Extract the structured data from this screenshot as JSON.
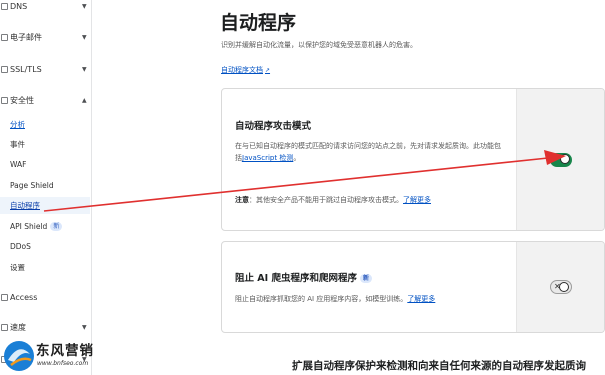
{
  "sidebar": {
    "items": [
      {
        "label": "DNS",
        "icon": "dns-icon"
      },
      {
        "label": "电子邮件",
        "icon": "email-icon"
      },
      {
        "label": "SSL/TLS",
        "icon": "lock-icon"
      },
      {
        "label": "安全性",
        "icon": "shield-icon"
      }
    ],
    "security_sub": [
      {
        "label": "分析"
      },
      {
        "label": "事件"
      },
      {
        "label": "WAF"
      },
      {
        "label": "Page Shield"
      },
      {
        "label": "自动程序"
      },
      {
        "label": "API Shield",
        "badge": "新"
      },
      {
        "label": "DDoS"
      },
      {
        "label": "设置"
      }
    ],
    "access": {
      "label": "Access"
    },
    "speed": {
      "label": "速度"
    },
    "cache": {
      "label": "缓存"
    }
  },
  "main": {
    "title": "自动程序",
    "description": "识别并缓解自动化流量，以保护您的域免受恶意机器人的危害。",
    "doc_link": "自动程序文档",
    "cards": [
      {
        "title": "自动程序攻击模式",
        "desc_before": "在与已知自动程序的模式匹配的请求访问您的站点之前，先对请求发起质询。此功能包括",
        "desc_link": "JavaScript 检测",
        "desc_after": "。",
        "note_label": "注意",
        "note_text": "：其他安全产品不能用于跳过自动程序攻击模式。",
        "note_link": "了解更多",
        "toggle": {
          "state": "on",
          "mark": "✓"
        }
      },
      {
        "title": "阻止 AI 爬虫程序和爬网程序",
        "badge": "新",
        "desc": "阻止自动程序抓取您的 AI 应用程序内容，如模型训练。",
        "desc_link": "了解更多",
        "toggle": {
          "state": "off",
          "mark": "✕"
        }
      }
    ],
    "bottom_heading": "扩展自动程序保护来检测和向来自任何来源的自动程序发起质询"
  },
  "watermark": {
    "title": "东风营销",
    "url": "www.bnfseo.com"
  },
  "colors": {
    "accent_link": "#0051c3",
    "toggle_on": "#18864b",
    "arrow": "#e0302f"
  }
}
